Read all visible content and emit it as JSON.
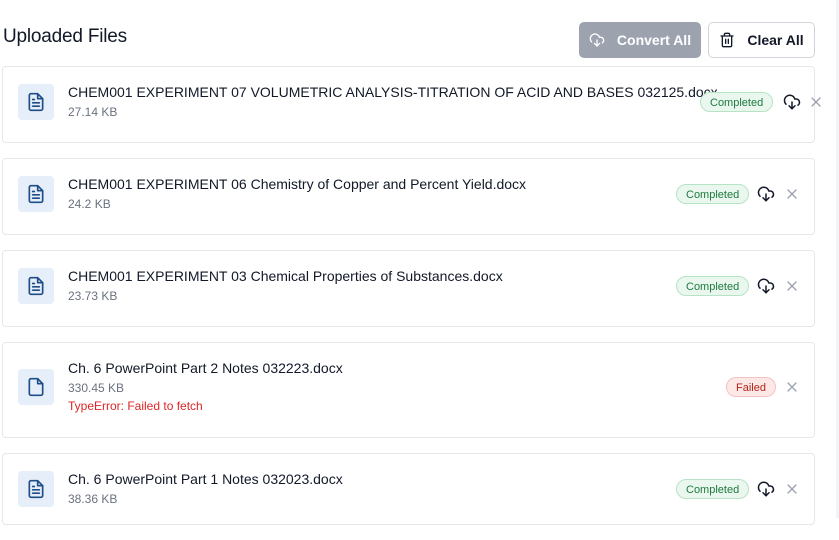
{
  "header": {
    "title": "Uploaded Files",
    "convert_all_label": "Convert All",
    "clear_all_label": "Clear All"
  },
  "files": [
    {
      "name": "CHEM001 EXPERIMENT 07 VOLUMETRIC ANALYSIS-TITRATION OF ACID AND BASES 032125.docx",
      "size": "27.14 KB",
      "status": "Completed",
      "error": ""
    },
    {
      "name": "CHEM001 EXPERIMENT 06 Chemistry of Copper and Percent Yield.docx",
      "size": "24.2 KB",
      "status": "Completed",
      "error": ""
    },
    {
      "name": "CHEM001 EXPERIMENT 03 Chemical Properties of Substances.docx",
      "size": "23.73 KB",
      "status": "Completed",
      "error": ""
    },
    {
      "name": "Ch. 6 PowerPoint Part 2 Notes 032223.docx",
      "size": "330.45 KB",
      "status": "Failed",
      "error": "TypeError: Failed to fetch"
    },
    {
      "name": "Ch. 6 PowerPoint Part 1 Notes 032023.docx",
      "size": "38.36 KB",
      "status": "Completed",
      "error": ""
    }
  ],
  "colors": {
    "convert_button_bg": "#9ca3af",
    "doc_badge_bg": "#e6eef9",
    "doc_icon": "#1d4e89",
    "completed_bg": "#e9f7ee",
    "completed_text": "#1f7a3f",
    "failed_bg": "#fde8e8",
    "failed_text": "#b42318",
    "error_text": "#dc2626"
  },
  "icons": {
    "convert": "cloud-download-icon",
    "clear": "trash-icon",
    "file_text": "file-text-icon",
    "file_blank": "file-icon",
    "download": "cloud-download-icon",
    "remove": "close-icon"
  }
}
